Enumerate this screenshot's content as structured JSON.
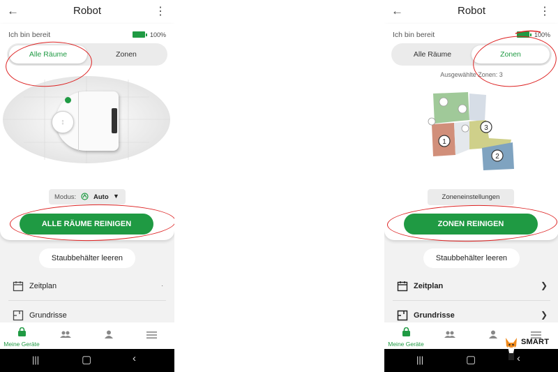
{
  "left": {
    "header": {
      "back_icon": "arrow-left-icon",
      "title": "Robot",
      "more_icon": "more-vertical-icon"
    },
    "status": {
      "label": "Ich bin bereit",
      "battery_pct": "100%"
    },
    "segmented": {
      "tab1": "Alle Räume",
      "tab2": "Zonen",
      "active": "tab1"
    },
    "mode": {
      "label": "Modus:",
      "value": "Auto"
    },
    "clean_button": "ALLE RÄUME REINIGEN",
    "dust_button": "Staubbehälter leeren",
    "list": [
      {
        "label": "Zeitplan",
        "icon": "calendar-icon"
      },
      {
        "label": "Grundrisse",
        "icon": "floorplan-icon"
      }
    ],
    "nav": {
      "devices_label": "Meine Geräte"
    }
  },
  "right": {
    "header": {
      "back_icon": "arrow-left-icon",
      "title": "Robot",
      "more_icon": "more-vertical-icon"
    },
    "status": {
      "label": "Ich bin bereit",
      "battery_pct": "100%"
    },
    "segmented": {
      "tab1": "Alle Räume",
      "tab2": "Zonen",
      "active": "tab2"
    },
    "zones_selected": "Ausgewählte Zonen: 3",
    "zones": [
      {
        "num": "1",
        "color": "#d18f7a"
      },
      {
        "num": "2",
        "color": "#7fa3c0"
      },
      {
        "num": "3",
        "color": "#cfd08a"
      }
    ],
    "zone_settings": "Zoneneinstellungen",
    "clean_button": "ZONEN REINIGEN",
    "dust_button": "Staubbehälter leeren",
    "list": [
      {
        "label": "Zeitplan",
        "icon": "calendar-icon"
      },
      {
        "label": "Grundrisse",
        "icon": "floorplan-icon"
      }
    ],
    "nav": {
      "devices_label": "Meine Geräte"
    }
  },
  "watermark": {
    "text": "SMART"
  },
  "colors": {
    "accent": "#1f9a43",
    "annotation": "#dd2222"
  }
}
